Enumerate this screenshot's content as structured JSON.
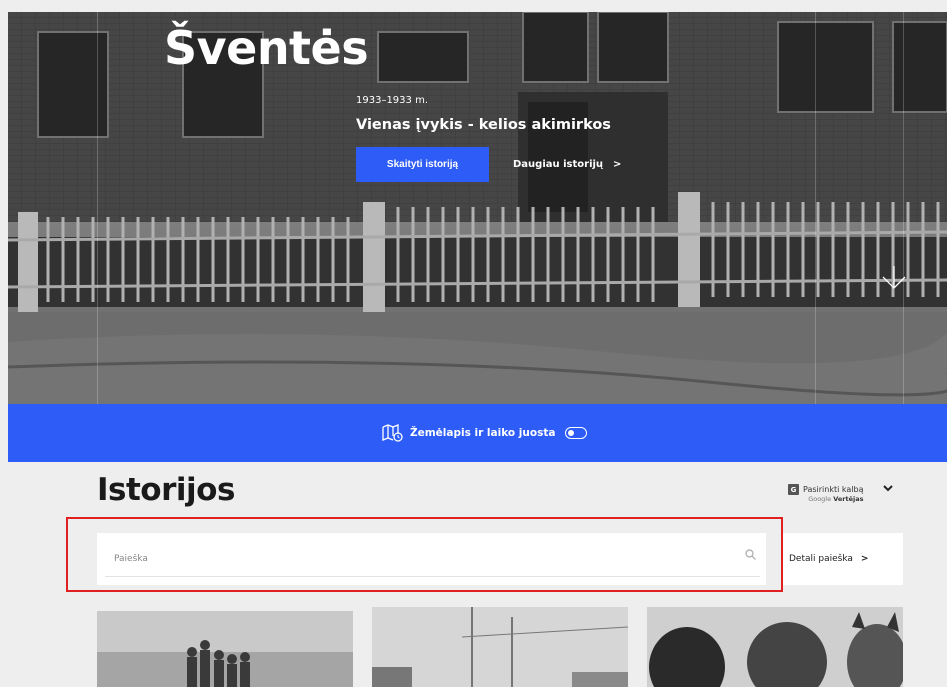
{
  "hero": {
    "title": "Šventės",
    "date": "1933–1933 m.",
    "subtitle": "Vienas įvykis - kelios akimirkos",
    "read_button": "Skaityti istoriją",
    "more_link": "Daugiau istorijų",
    "more_chevron": ">"
  },
  "bar": {
    "label": "Žemėlapis ir laiko juosta"
  },
  "stories": {
    "title": "Istorijos",
    "translate_label": "Pasirinkti kalbą",
    "translate_brand_google": "Google",
    "translate_brand_name": "Vertėjas",
    "search_placeholder": "Paieška",
    "detail_search": "Detali paieška",
    "detail_chevron": ">"
  },
  "colors": {
    "accent": "#2d5cf6",
    "highlight": "#e02020"
  },
  "icons": [
    "map-time-icon",
    "toggle-switch",
    "scroll-down-icon",
    "google-translate-icon",
    "chevron-down-icon",
    "search-icon",
    "chevron-right-icon"
  ]
}
